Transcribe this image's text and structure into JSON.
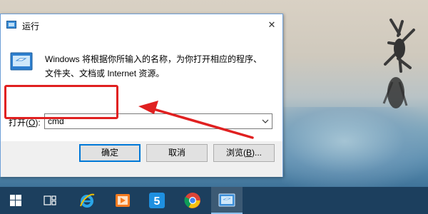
{
  "dialog": {
    "title": "运行",
    "close_glyph": "✕",
    "description_line1": "Windows 将根据你所输入的名称，为你打开相应的程序、",
    "description_line2": "文件夹、文档或 Internet 资源。",
    "open_label_prefix": "打开(",
    "open_label_key": "O",
    "open_label_suffix": "):",
    "input_value": "cmd",
    "ok_label": "确定",
    "cancel_label": "取消",
    "browse_label_prefix": "浏览(",
    "browse_label_key": "B",
    "browse_label_suffix": ")..."
  },
  "taskbar": {
    "items": [
      {
        "name": "start-button",
        "icon": "windows-logo-icon"
      },
      {
        "name": "task-view-button",
        "icon": "task-view-icon"
      },
      {
        "name": "internet-explorer-button",
        "icon": "ie-icon"
      },
      {
        "name": "media-player-button",
        "icon": "media-player-icon"
      },
      {
        "name": "app-s-button",
        "icon": "s-app-icon"
      },
      {
        "name": "chrome-button",
        "icon": "chrome-icon"
      },
      {
        "name": "run-app-button",
        "icon": "run-icon",
        "active": true
      }
    ]
  },
  "colors": {
    "annotation": "#e02020",
    "taskbar": "#1c3f5e",
    "accent": "#0078d7"
  }
}
